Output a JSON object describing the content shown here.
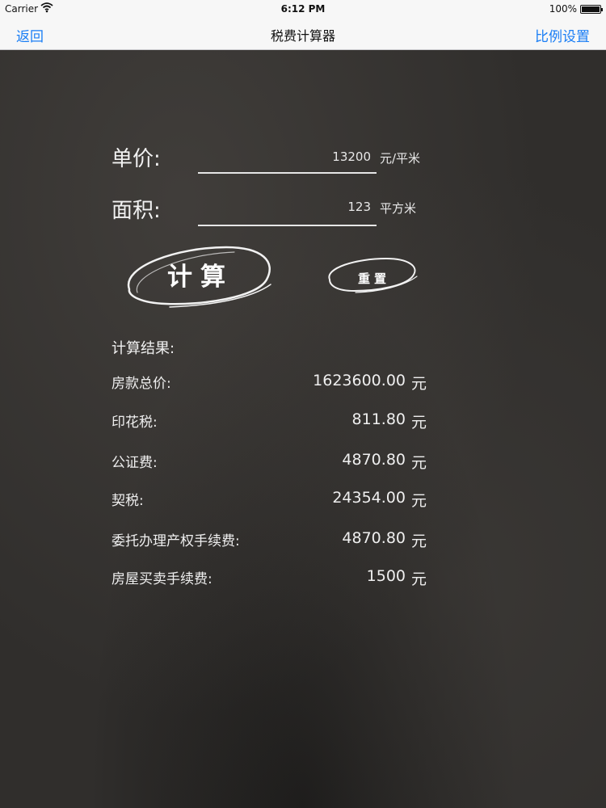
{
  "status_bar": {
    "carrier": "Carrier",
    "time": "6:12 PM",
    "battery_text": "100%",
    "battery_level": 1.0
  },
  "nav": {
    "back_label": "返回",
    "title": "税费计算器",
    "settings_label": "比例设置"
  },
  "form": {
    "unit_price": {
      "label": "单价:",
      "value": "13200",
      "unit": "元/平米"
    },
    "area": {
      "label": "面积:",
      "value": "123",
      "unit": "平方米"
    }
  },
  "buttons": {
    "calculate_label": "计算",
    "reset_label": "重置"
  },
  "results": {
    "title": "计算结果:",
    "rows": [
      {
        "label": "房款总价:",
        "value": "1623600.00",
        "unit": "元"
      },
      {
        "label": "印花税:",
        "value": "811.80",
        "unit": "元"
      },
      {
        "label": "公证费:",
        "value": "4870.80",
        "unit": "元"
      },
      {
        "label": "契税:",
        "value": "24354.00",
        "unit": "元"
      },
      {
        "label": "委托办理产权手续费:",
        "value": "4870.80",
        "unit": "元"
      },
      {
        "label": "房屋买卖手续费:",
        "value": "1500",
        "unit": "元"
      }
    ]
  },
  "colors": {
    "accent": "#1a7ef5",
    "chalkboard": "#302e2c",
    "chalk": "#f2f2f2"
  }
}
